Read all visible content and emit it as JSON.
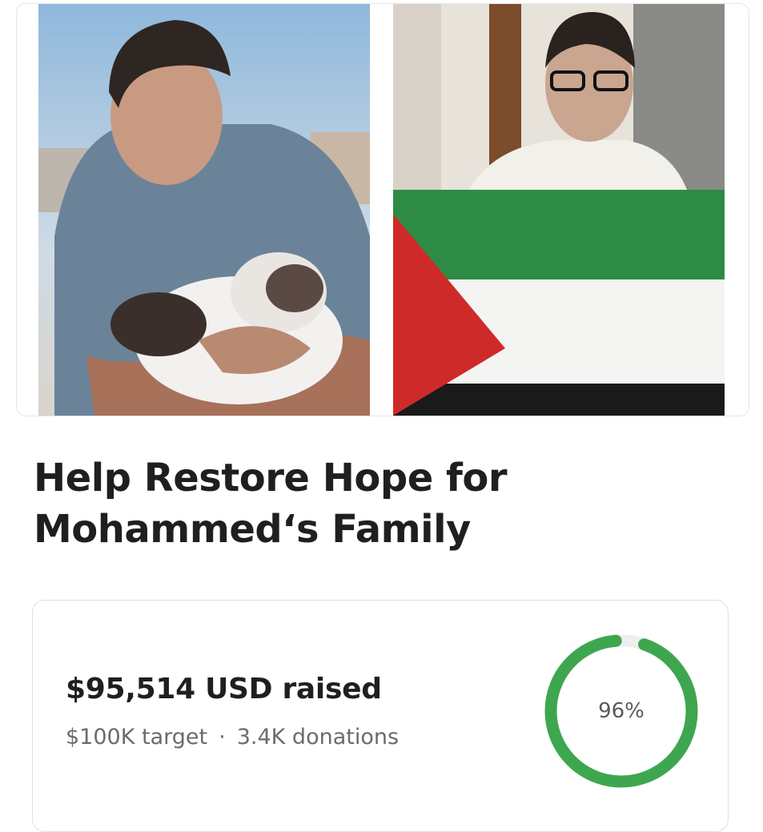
{
  "campaign": {
    "title": "Help Restore Hope for Mohammed‘s Family",
    "photos": [
      "photo-young-man-with-cat",
      "photo-boy-with-palestinian-flag"
    ]
  },
  "stats": {
    "raised": "$95,514 USD raised",
    "target": "$100K target",
    "separator": "·",
    "donations": "3.4K donations",
    "progress_label": "96%",
    "progress_fraction": 0.96,
    "progress_color": "#3fa650",
    "track_color": "#eeeeee"
  }
}
